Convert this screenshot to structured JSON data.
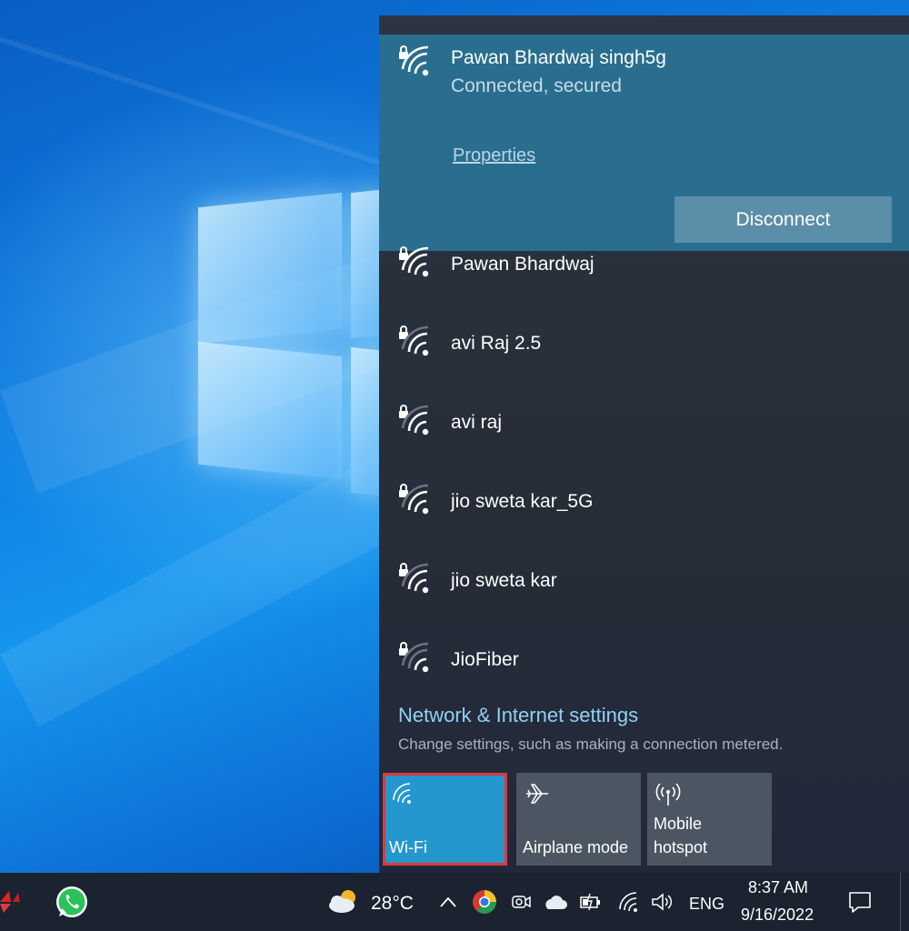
{
  "connected_network": {
    "name": "Pawan Bhardwaj singh5g",
    "status": "Connected, secured",
    "properties_label": "Properties",
    "disconnect_label": "Disconnect"
  },
  "networks": [
    {
      "name": "Pawan Bhardwaj"
    },
    {
      "name": "avi Raj 2.5"
    },
    {
      "name": "avi raj"
    },
    {
      "name": "jio sweta kar_5G"
    },
    {
      "name": "jio sweta kar"
    },
    {
      "name": "JioFiber"
    }
  ],
  "settings": {
    "link_label": "Network & Internet settings",
    "description": "Change settings, such as making a connection metered."
  },
  "quick_actions": [
    {
      "label": "Wi-Fi",
      "icon": "wifi-icon",
      "active": true
    },
    {
      "label": "Airplane mode",
      "icon": "airplane-icon",
      "active": false
    },
    {
      "label": "Mobile\nhotspot",
      "icon": "hotspot-icon",
      "active": false
    }
  ],
  "taskbar": {
    "weather_temp": "28°C",
    "language": "ENG",
    "time": "8:37 AM",
    "date": "9/16/2022"
  },
  "colors": {
    "accent": "#2597cf",
    "highlight_border": "#e0383b",
    "link": "#8fd1f5"
  }
}
